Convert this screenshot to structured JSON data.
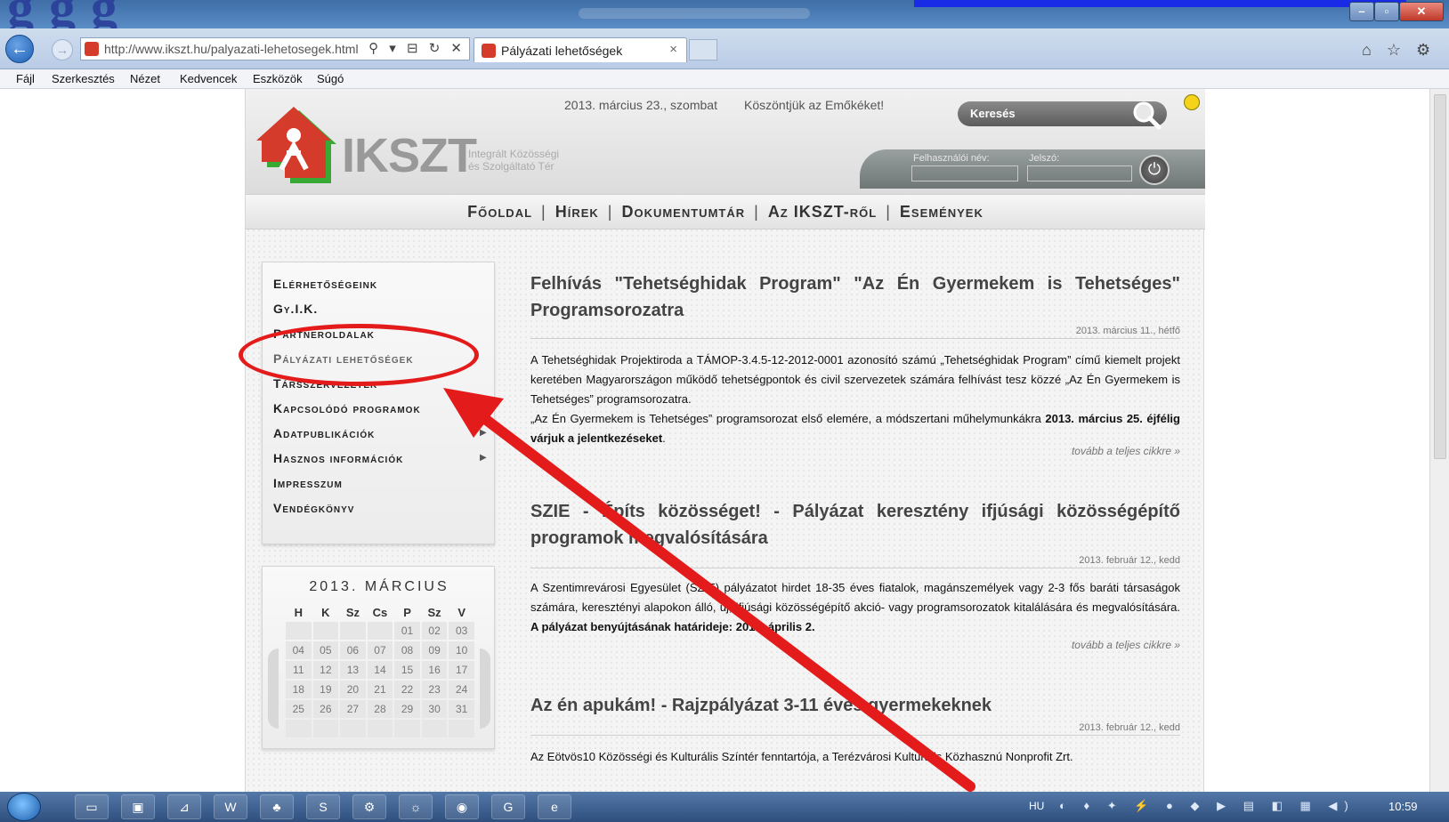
{
  "browser": {
    "url": "http://www.ikszt.hu/palyazati-lehetosegek.html",
    "tab_title": "Pályázati lehetőségek",
    "tab_close": "×",
    "menu": [
      "Fájl",
      "Szerkesztés",
      "Nézet",
      "Kedvencek",
      "Eszközök",
      "Súgó"
    ],
    "window_buttons": {
      "minimize": "–",
      "maximize": "▫",
      "close": "✕"
    },
    "right_tools": "⌂ ☆ ⚙",
    "url_tools": "⚲ ▾ ⊟ ↻ ✕"
  },
  "overlay": {
    "heading": "g   g   g"
  },
  "header": {
    "logo_text": "IKSZT",
    "logo_sub_line1": "Integrált Közösségi",
    "logo_sub_line2": "és Szolgáltató Tér",
    "date": "2013. március 23., szombat",
    "welcome": "Köszöntjük az Emőkéket!",
    "search_label": "Keresés",
    "username_label": "Felhasználói név:",
    "password_label": "Jelszó:",
    "power_glyph": "⏻"
  },
  "nav": {
    "items": [
      "Főoldal",
      "Hírek",
      "Dokumentumtár",
      "Az IKSZT-ről",
      "Események"
    ],
    "separator": "|"
  },
  "sidemenu": {
    "items": [
      {
        "label": "Elérhetőségeink",
        "submenu": false
      },
      {
        "label": "Gy.I.K.",
        "submenu": false
      },
      {
        "label": "Partneroldalak",
        "submenu": false
      },
      {
        "label": "Pályázati lehetőségek",
        "submenu": false
      },
      {
        "label": "Társszervezetek",
        "submenu": false
      },
      {
        "label": "Kapcsolódó programok",
        "submenu": false
      },
      {
        "label": "Adatpublikációk",
        "submenu": true
      },
      {
        "label": "Hasznos információk",
        "submenu": true
      },
      {
        "label": "Impresszum",
        "submenu": false
      },
      {
        "label": "Vendégkönyv",
        "submenu": false
      }
    ],
    "active_index": 3,
    "arrow": "▶"
  },
  "calendar": {
    "title": "2013. MÁRCIUS",
    "weekdays": [
      "H",
      "K",
      "Sz",
      "Cs",
      "P",
      "Sz",
      "V"
    ],
    "weeks": [
      [
        "",
        "",
        "",
        "",
        "01",
        "02",
        "03"
      ],
      [
        "04",
        "05",
        "06",
        "07",
        "08",
        "09",
        "10"
      ],
      [
        "11",
        "12",
        "13",
        "14",
        "15",
        "16",
        "17"
      ],
      [
        "18",
        "19",
        "20",
        "21",
        "22",
        "23",
        "24"
      ],
      [
        "25",
        "26",
        "27",
        "28",
        "29",
        "30",
        "31"
      ],
      [
        "",
        "",
        "",
        "",
        "",
        "",
        ""
      ]
    ]
  },
  "articles": [
    {
      "title": "Felhívás \"Tehetséghidak Program\" \"Az Én Gyermekem is Tehetséges\" Programsorozatra",
      "date": "2013. március 11., hétfő",
      "body": [
        {
          "text": "A Tehetséghidak Projektiroda a TÁMOP-3.4.5-12-2012-0001 azonosító számú „Tehetséghidak Program” című kiemelt projekt keretében Magyarországon működő tehetségpontok és civil szervezetek számára felhívást tesz közzé „Az Én Gyermekem is Tehetséges” programsorozatra."
        },
        {
          "text": "„Az Én Gyermekem is Tehetséges” programsorozat első elemére, a módszertani műhelymunkákra ",
          "bold": "2013. március 25. éjfélig várjuk a jelentkezéseket",
          "tail": "."
        }
      ],
      "more": "tovább a teljes cikkre »"
    },
    {
      "title": "SZIE - Építs közösséget! - Pályázat keresztény ifjúsági közösségépítő programok megvalósítására",
      "date": "2013. február 12., kedd",
      "body": [
        {
          "text": "A Szentimrevárosi Egyesület (SZIE) pályázatot hirdet 18-35 éves fiatalok, magánszemélyek vagy 2-3 fős baráti társaságok számára, keresztényi alapokon álló, új, ifjúsági közösségépítő akció- vagy programsorozatok kitalálására és megvalósítására. ",
          "bold": "A pályázat benyújtásának határideje: 2013. április 2.",
          "tail": ""
        }
      ],
      "more": "tovább a teljes cikkre »"
    },
    {
      "title": "Az én apukám! - Rajzpályázat 3-11 éves gyermekeknek",
      "date": "2013. február 12., kedd",
      "body": [
        {
          "text": "Az Eötvös10 Közösségi és Kulturális Színtér fenntartója, a Terézvárosi Kulturális Közhasznú Nonprofit Zrt."
        }
      ],
      "more": ""
    }
  ],
  "taskbar": {
    "buttons": [
      "▭",
      "▣",
      "⊿",
      "W",
      "♣",
      "S",
      "⚙",
      "☼",
      "◉",
      "G",
      "e"
    ],
    "language": "HU",
    "tray_icons": "◐ ♦ ✦ ⚡ ● ◆ ▶ ▤ ◧ ▦ ◀)",
    "clock": "10:59"
  },
  "colors": {
    "annotation": "#e41b1b",
    "titlebar": "#3f6ea6",
    "logo_red": "#d53b2a",
    "logo_green": "#39a935"
  }
}
